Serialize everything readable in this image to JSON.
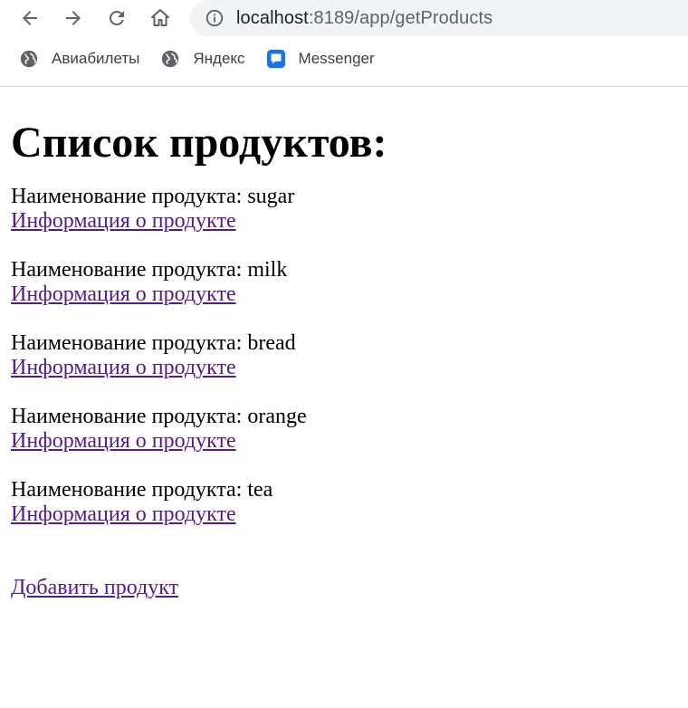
{
  "browser": {
    "url_host": "localhost",
    "url_path": ":8189/app/getProducts",
    "bookmarks": [
      {
        "label": "Авиабилеты",
        "icon": "globe-icon"
      },
      {
        "label": "Яндекс",
        "icon": "globe-icon"
      },
      {
        "label": "Messenger",
        "icon": "messenger-icon"
      }
    ]
  },
  "page": {
    "title": "Список продуктов:",
    "products": [
      {
        "name_line": "Наименование продукта: sugar",
        "link": "Информация о продукте"
      },
      {
        "name_line": "Наименование продукта: milk",
        "link": "Информация о продукте"
      },
      {
        "name_line": "Наименование продукта: bread",
        "link": "Информация о продукте"
      },
      {
        "name_line": "Наименование продукта: orange",
        "link": "Информация о продукте"
      },
      {
        "name_line": "Наименование продукта: tea",
        "link": "Информация о продукте"
      }
    ],
    "add_link": "Добавить продукт"
  },
  "colors": {
    "link_visited": "#551a8b",
    "omnibox_bg": "#f1f3f4",
    "messenger_blue": "#1a73e8"
  }
}
